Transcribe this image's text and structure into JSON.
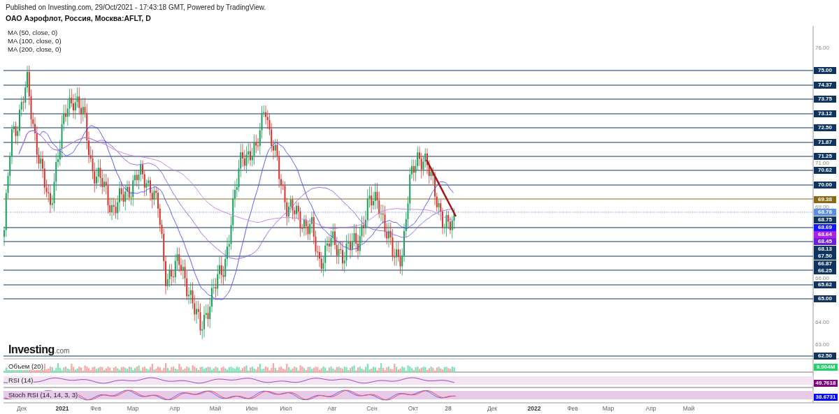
{
  "header": {
    "published": "Published on Investing.com, 29/Oct/2021 - 17:43:18 GMT, Powered by TradingView.",
    "title": "ОАО Аэрофлот, Россия, Москва:AFLT, D"
  },
  "indicators": [
    "MA (50, close, 0)",
    "MA (100, close, 0)",
    "MA (200, close, 0)"
  ],
  "logo": {
    "name": "Investing",
    "suffix": ".com"
  },
  "price_axis": {
    "ticks": [
      "76.00",
      "71.00",
      "69.00",
      "66.00",
      "64.00",
      "63.00"
    ],
    "labels": [
      {
        "text": "75.00",
        "color": "#0f3460",
        "kind": "line"
      },
      {
        "text": "74.37",
        "color": "#0f3460",
        "kind": "line"
      },
      {
        "text": "73.75",
        "color": "#0f3460",
        "kind": "line"
      },
      {
        "text": "73.12",
        "color": "#0f3460",
        "kind": "line"
      },
      {
        "text": "72.50",
        "color": "#0f3460",
        "kind": "line"
      },
      {
        "text": "71.87",
        "color": "#0f3460",
        "kind": "line"
      },
      {
        "text": "71.25",
        "color": "#0f3460",
        "kind": "line"
      },
      {
        "text": "70.62",
        "color": "#0f3460",
        "kind": "line"
      },
      {
        "text": "70.00",
        "color": "#0f3460",
        "kind": "line"
      },
      {
        "text": "69.38",
        "color": "#8b6914",
        "kind": "line"
      },
      {
        "text": "68.78",
        "color": "#5a8de6",
        "kind": "dotted"
      },
      {
        "text": "68.75",
        "color": "#0f3460",
        "kind": "marker"
      },
      {
        "text": "68.69",
        "color": "#1515ff",
        "kind": "marker"
      },
      {
        "text": "68.64",
        "color": "#b01ee8",
        "kind": "marker"
      },
      {
        "text": "68.45",
        "color": "#6a1fe0",
        "kind": "marker"
      },
      {
        "text": "68.13",
        "color": "#0f3460",
        "kind": "line"
      },
      {
        "text": "67.50",
        "color": "#0f3460",
        "kind": "line"
      },
      {
        "text": "66.87",
        "color": "#0f3460",
        "kind": "line"
      },
      {
        "text": "66.25",
        "color": "#0f3460",
        "kind": "line"
      },
      {
        "text": "65.62",
        "color": "#0f3460",
        "kind": "line"
      },
      {
        "text": "65.00",
        "color": "#0f3460",
        "kind": "line"
      },
      {
        "text": "62.50",
        "color": "#0f3460",
        "kind": "line"
      }
    ]
  },
  "panes": [
    {
      "kind": "volume",
      "label": "Объем (20)",
      "value": "9.904M",
      "color": "#22d36b"
    },
    {
      "kind": "rsi",
      "label": "RSI (14)",
      "value": "49.7618",
      "color": "#800080"
    },
    {
      "kind": "stoch",
      "label": "Stoch RSI (14, 14, 3, 3)",
      "value": "38.6731",
      "color": "#0000ff"
    }
  ],
  "time_axis": [
    {
      "text": "Дек",
      "kind": "month"
    },
    {
      "text": "2021",
      "kind": "year"
    },
    {
      "text": "Фев",
      "kind": "month"
    },
    {
      "text": "Мар",
      "kind": "month"
    },
    {
      "text": "Апр",
      "kind": "month"
    },
    {
      "text": "Май",
      "kind": "month"
    },
    {
      "text": "Июн",
      "kind": "month"
    },
    {
      "text": "Июл",
      "kind": "month"
    },
    {
      "text": "Авг",
      "kind": "month"
    },
    {
      "text": "Сен",
      "kind": "month"
    },
    {
      "text": "Окт",
      "kind": "month"
    },
    {
      "text": "28",
      "kind": "day"
    },
    {
      "text": "Дек",
      "kind": "month"
    },
    {
      "text": "2022",
      "kind": "year"
    },
    {
      "text": "Фев",
      "kind": "month"
    },
    {
      "text": "Мар",
      "kind": "month"
    },
    {
      "text": "Апр",
      "kind": "month"
    },
    {
      "text": "Май",
      "kind": "month"
    }
  ]
}
